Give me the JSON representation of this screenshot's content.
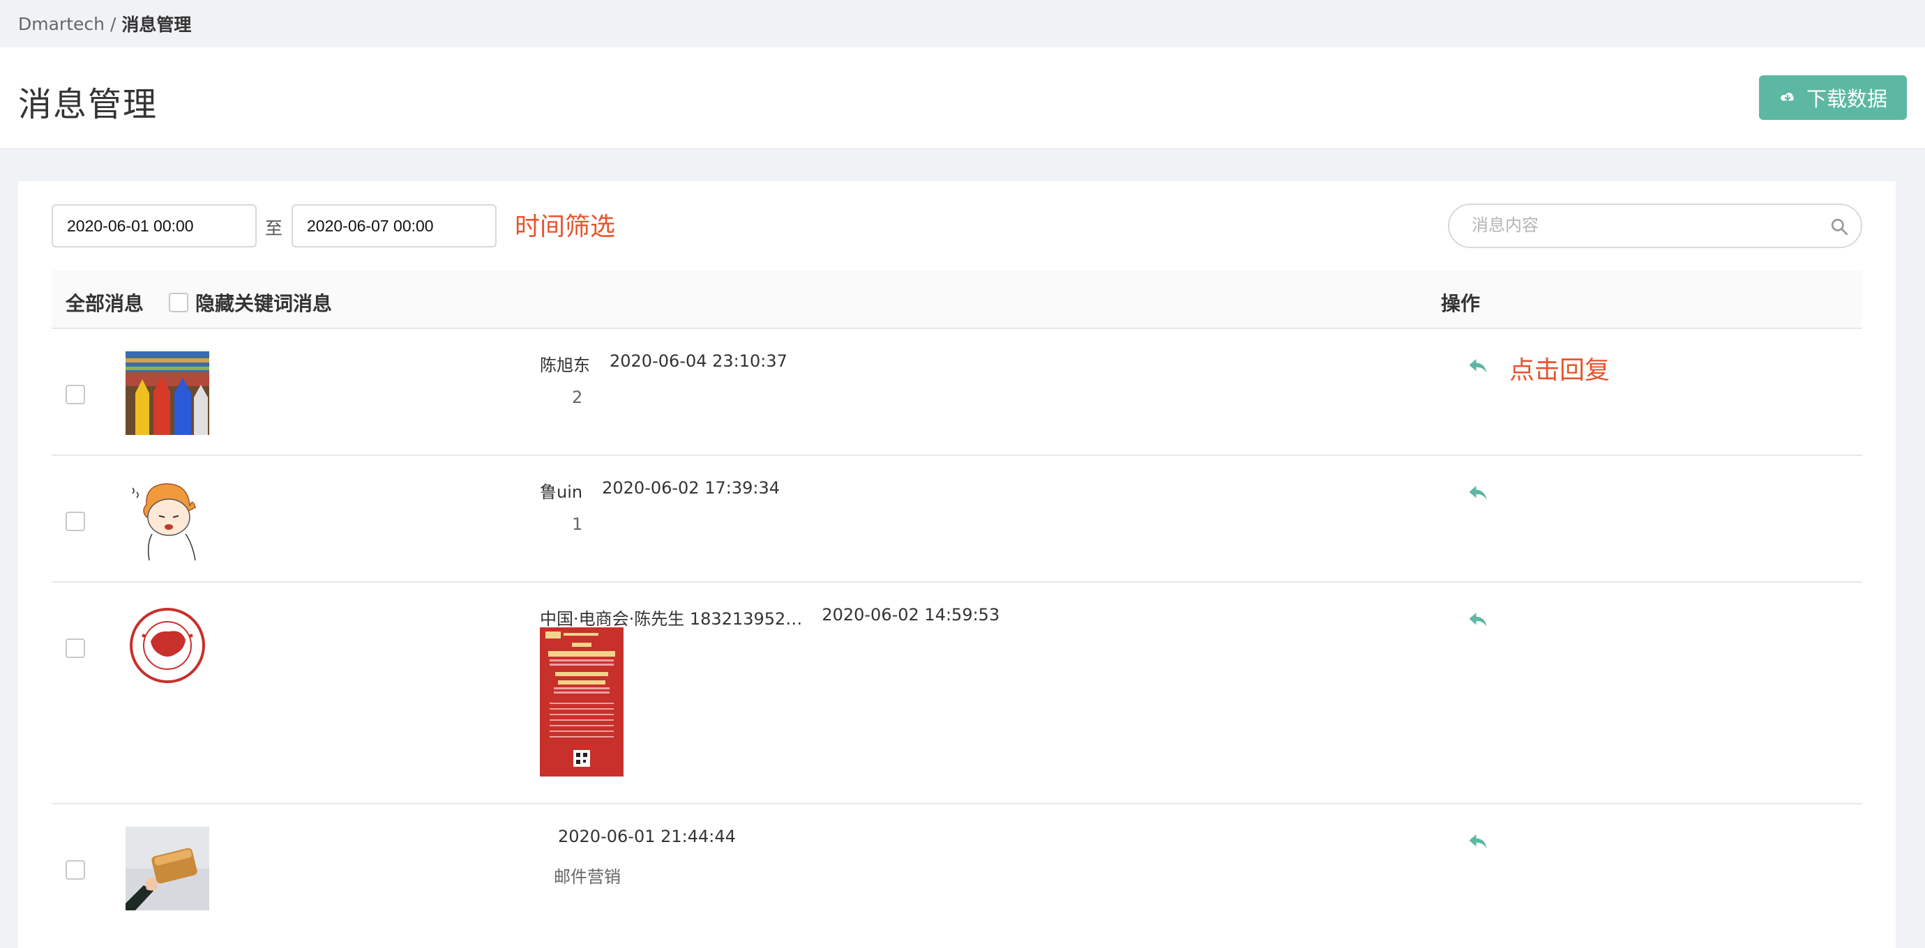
{
  "breadcrumb": {
    "root": "Dmartech",
    "separator": "/",
    "current": "消息管理"
  },
  "header": {
    "title": "消息管理",
    "download_label": "下载数据"
  },
  "filter": {
    "start_date": "2020-06-01 00:00",
    "range_separator": "至",
    "end_date": "2020-06-07 00:00",
    "annotation": "时间筛选"
  },
  "search": {
    "placeholder": "消息内容",
    "value": ""
  },
  "table": {
    "col_all": "全部消息",
    "col_hide_keyword": "隐藏关键词消息",
    "col_operation": "操作",
    "reply_annotation": "点击回复"
  },
  "messages": [
    {
      "sender": "陈旭东",
      "time": "2020-06-04 23:10:37",
      "content": "2",
      "avatar": "colored-pencils"
    },
    {
      "sender": "鲁uin",
      "time": "2020-06-02 17:39:34",
      "content": "1",
      "avatar": "cartoon-boy"
    },
    {
      "sender": "中国·电商会·陈先生 183213952…",
      "time": "2020-06-02 14:59:53",
      "content": "",
      "avatar": "china-seal",
      "attachment": "poster-image"
    },
    {
      "sender": "",
      "time": "2020-06-01 21:44:44",
      "content": "邮件营销",
      "avatar": "hand-with-bread"
    }
  ],
  "colors": {
    "accent": "#5cb8a2",
    "annotation": "#e8542c"
  }
}
